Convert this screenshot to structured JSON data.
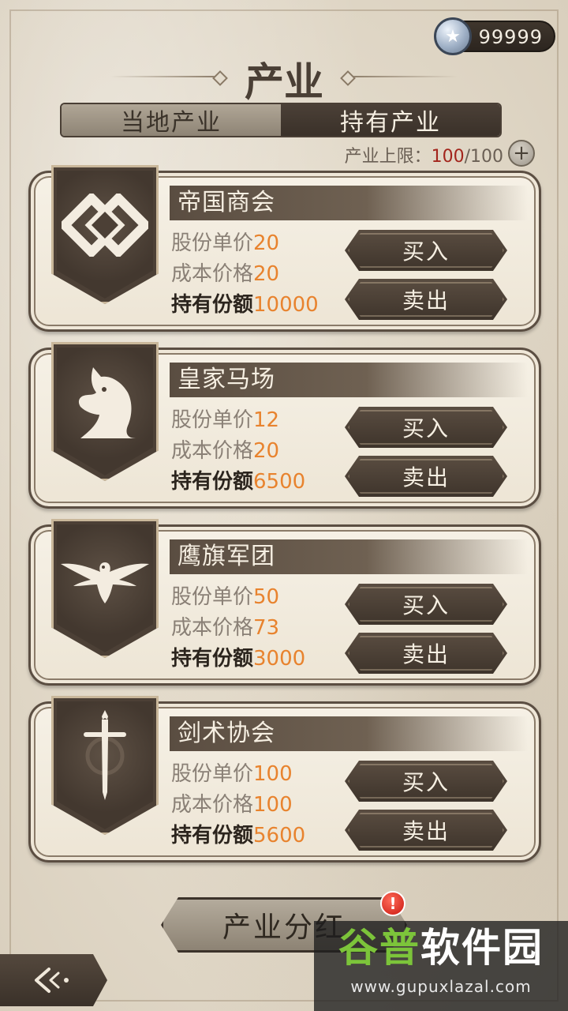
{
  "header": {
    "currency_value": "99999",
    "currency_icon": "silver-star-coin-icon",
    "title": "产业"
  },
  "tabs": [
    {
      "label": "当地产业",
      "active": false
    },
    {
      "label": "持有产业",
      "active": true
    }
  ],
  "limit": {
    "label": "产业上限：",
    "current": "100",
    "separator": "/",
    "max": "100"
  },
  "labels": {
    "price": "股份单价",
    "cost": "成本价格",
    "hold": "持有份额",
    "buy": "买入",
    "sell": "卖出"
  },
  "industries": [
    {
      "name": "帝国商会",
      "price": "20",
      "cost": "20",
      "hold": "10000",
      "emblem": "interlocked-diamonds-icon"
    },
    {
      "name": "皇家马场",
      "price": "12",
      "cost": "20",
      "hold": "6500",
      "emblem": "horse-head-icon"
    },
    {
      "name": "鹰旗军团",
      "price": "50",
      "cost": "73",
      "hold": "3000",
      "emblem": "eagle-icon"
    },
    {
      "name": "剑术协会",
      "price": "100",
      "cost": "100",
      "hold": "5600",
      "emblem": "sword-icon"
    }
  ],
  "footer": {
    "dividend_label": "产业分红",
    "alert": "!",
    "back_icon": "back-arrow-icon"
  },
  "watermark": {
    "text_a": "谷普",
    "text_b": "软件园",
    "url": "www.gupuxlazal.com"
  },
  "colors": {
    "accent_orange": "#e8832e",
    "limit_red": "#a3251c",
    "dark_brown": "#4a3f35"
  }
}
